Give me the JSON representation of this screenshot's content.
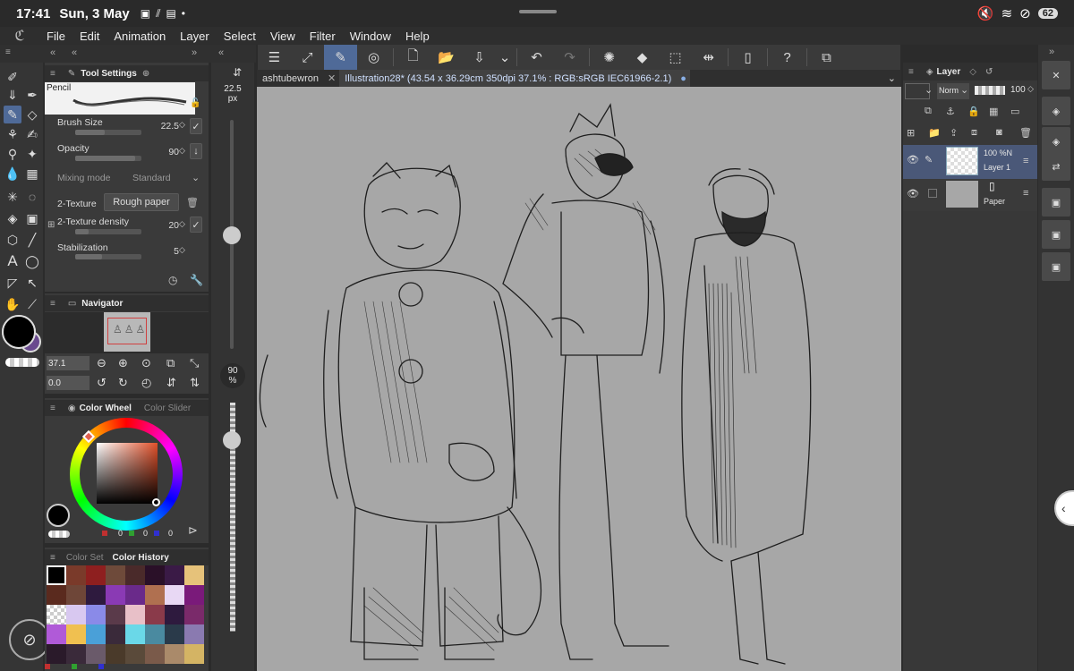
{
  "status": {
    "time": "17:41",
    "date": "Sun, 3 May",
    "battery": "62"
  },
  "menu": [
    "File",
    "Edit",
    "Animation",
    "Layer",
    "Select",
    "View",
    "Filter",
    "Window",
    "Help"
  ],
  "tabs": [
    {
      "label": "ashtubewron"
    },
    {
      "label": "Illustration28* (43.54 x 36.29cm 350dpi 37.1% : RGB:sRGB IEC61966-2.1)"
    }
  ],
  "tool_settings": {
    "title": "Tool Settings",
    "brush_name": "Pencil",
    "brush_size_label": "Brush Size",
    "brush_size_value": "22.5",
    "brush_size_fraction": 0.45,
    "opacity_label": "Opacity",
    "opacity_value": "90",
    "opacity_fraction": 0.9,
    "mixing_mode_label": "Mixing mode",
    "mixing_mode_value": "Standard",
    "texture_label": "2-Texture",
    "texture_value": "Rough paper",
    "texture_density_label": "2-Texture density",
    "texture_density_value": "20",
    "texture_density_fraction": 0.2,
    "stabilization_label": "Stabilization",
    "stabilization_value": "5",
    "stabilization_fraction": 0.4
  },
  "navigator": {
    "title": "Navigator",
    "zoom_value": "37.1",
    "rotate_value": "0.0"
  },
  "color_panel": {
    "tab_wheel": "Color Wheel",
    "tab_slider": "Color Slider",
    "r_value": "0",
    "g_value": "0",
    "b_value": "0"
  },
  "color_set": {
    "tab_set": "Color Set",
    "tab_history": "Color History",
    "swatches": [
      "#000000",
      "#7a3a2a",
      "#8e1f1f",
      "#6e4a3a",
      "#4a2a2a",
      "#2a1028",
      "#3a1a46",
      "#e6c27a",
      "#5a2a1e",
      "#6e4638",
      "#2e1a3e",
      "#8a3ab4",
      "#6a2a8a",
      "#b07050",
      "#e8d8f4",
      "#7a1a7a",
      "#ffffff",
      "#d8c8f0",
      "#8a8ae8",
      "#5a3a4a",
      "#e8c0c8",
      "#8a3a4a",
      "#2e1a3e",
      "#7a2a6a",
      "#b05ad8",
      "#f0c050",
      "#4aa0d8",
      "#3a2a3a",
      "#6ad8e8",
      "#4a8aa0",
      "#2a3a4a",
      "#8a7ab0",
      "#2a1a2a",
      "#3a2a3a",
      "#6a5a6a",
      "#4a3a2a",
      "#5a4a3a",
      "#7a5a4a",
      "#aa8a6a",
      "#d4b464"
    ]
  },
  "size_column": {
    "size_value": "22.5",
    "size_unit": "px",
    "size_fraction": 0.45,
    "opacity_value": "90",
    "opacity_unit": "%",
    "opacity_fraction": 0.9
  },
  "layer_panel": {
    "title": "Layer",
    "blend_mode": "Norm",
    "opacity": "100",
    "layers": [
      {
        "name": "Layer 1",
        "info": "100 %N"
      },
      {
        "name": "Paper",
        "info": ""
      }
    ]
  }
}
